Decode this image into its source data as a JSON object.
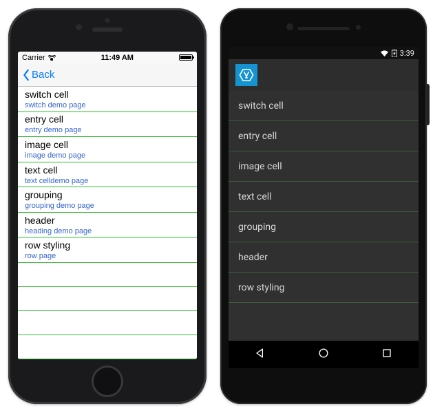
{
  "ios": {
    "status": {
      "carrier": "Carrier",
      "time": "11:49 AM"
    },
    "nav_back": "Back",
    "rows": [
      {
        "title": "switch cell",
        "subtitle": "switch demo page"
      },
      {
        "title": "entry cell",
        "subtitle": "entry demo page"
      },
      {
        "title": "image cell",
        "subtitle": "image demo page"
      },
      {
        "title": "text cell",
        "subtitle": "text celldemo page"
      },
      {
        "title": "grouping",
        "subtitle": "grouping demo page"
      },
      {
        "title": "header",
        "subtitle": "heading demo page"
      },
      {
        "title": "row styling",
        "subtitle": "row page"
      }
    ]
  },
  "android": {
    "status": {
      "time": "3:39"
    },
    "rows": [
      {
        "title": "switch cell"
      },
      {
        "title": "entry cell"
      },
      {
        "title": "image cell"
      },
      {
        "title": "text cell"
      },
      {
        "title": "grouping"
      },
      {
        "title": "header"
      },
      {
        "title": "row styling"
      }
    ]
  }
}
